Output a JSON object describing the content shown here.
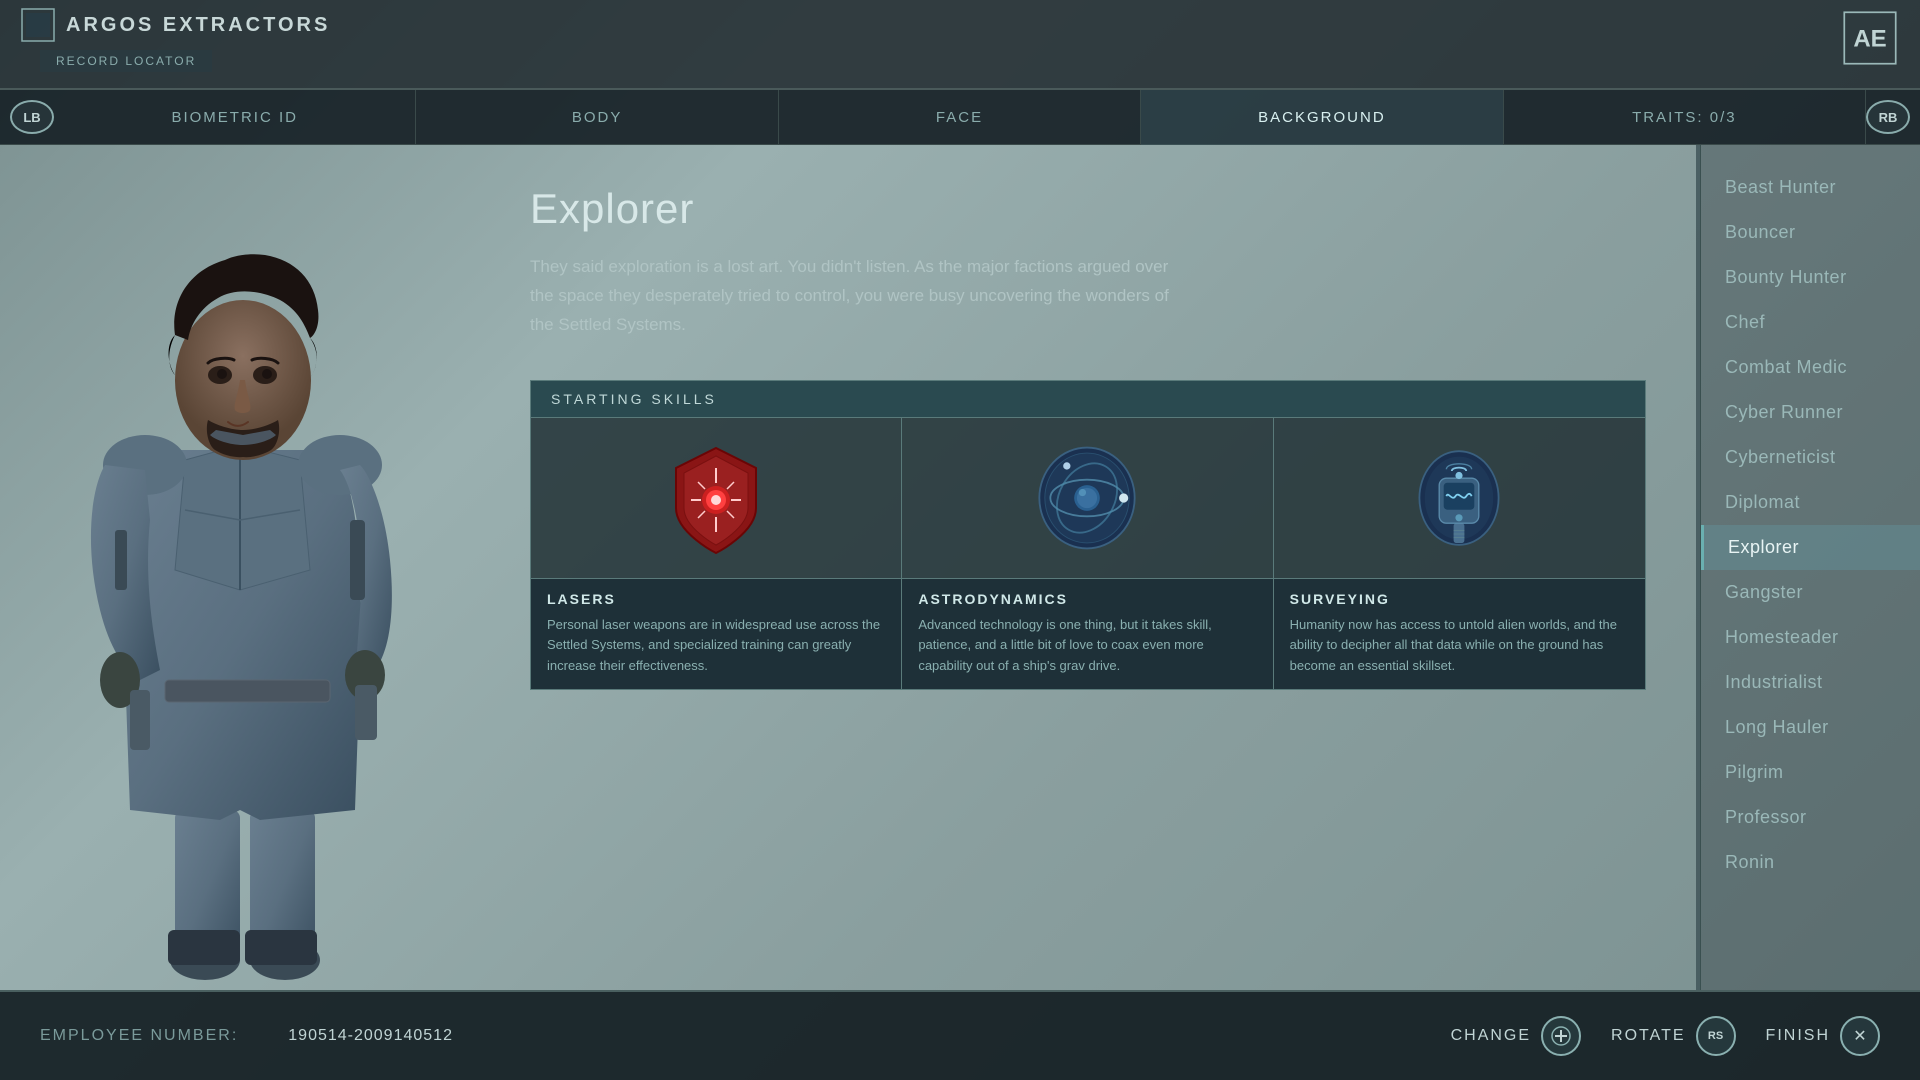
{
  "header": {
    "company": "ARGOS EXTRACTORS",
    "record_locator": "RECORD LOCATOR",
    "ae_logo": "AE"
  },
  "nav": {
    "left_btn": "LB",
    "right_btn": "RB",
    "tabs": [
      {
        "label": "BIOMETRIC ID",
        "id": "biometric"
      },
      {
        "label": "BODY",
        "id": "body"
      },
      {
        "label": "FACE",
        "id": "face"
      },
      {
        "label": "BACKGROUND",
        "id": "background",
        "active": true
      },
      {
        "label": "TRAITS: 0/3",
        "id": "traits"
      }
    ]
  },
  "background": {
    "title": "Explorer",
    "description": "They said exploration is a lost art. You didn't listen. As the major factions argued over the space they desperately tried to control, you were busy uncovering the wonders of the Settled Systems.",
    "skills_header": "STARTING SKILLS",
    "skills": [
      {
        "name": "LASERS",
        "description": "Personal laser weapons are in widespread use across the Settled Systems, and specialized training can greatly increase their effectiveness.",
        "icon_type": "laser"
      },
      {
        "name": "ASTRODYNAMICS",
        "description": "Advanced technology is one thing, but it takes skill, patience, and a little bit of love to coax even more capability out of a ship's grav drive.",
        "icon_type": "astro"
      },
      {
        "name": "SURVEYING",
        "description": "Humanity now has access to untold alien worlds, and the ability to decipher all that data while on the ground has become an essential skillset.",
        "icon_type": "survey"
      }
    ]
  },
  "bg_list": {
    "items": [
      {
        "label": "Beast Hunter",
        "id": "beast-hunter",
        "active": false
      },
      {
        "label": "Bouncer",
        "id": "bouncer",
        "active": false
      },
      {
        "label": "Bounty Hunter",
        "id": "bounty-hunter",
        "active": false
      },
      {
        "label": "Chef",
        "id": "chef",
        "active": false
      },
      {
        "label": "Combat Medic",
        "id": "combat-medic",
        "active": false
      },
      {
        "label": "Cyber Runner",
        "id": "cyber-runner",
        "active": false
      },
      {
        "label": "Cyberneticist",
        "id": "cyberneticist",
        "active": false
      },
      {
        "label": "Diplomat",
        "id": "diplomat",
        "active": false
      },
      {
        "label": "Explorer",
        "id": "explorer",
        "active": true
      },
      {
        "label": "Gangster",
        "id": "gangster",
        "active": false
      },
      {
        "label": "Homesteader",
        "id": "homesteader",
        "active": false
      },
      {
        "label": "Industrialist",
        "id": "industrialist",
        "active": false
      },
      {
        "label": "Long Hauler",
        "id": "long-hauler",
        "active": false
      },
      {
        "label": "Pilgrim",
        "id": "pilgrim",
        "active": false
      },
      {
        "label": "Professor",
        "id": "professor",
        "active": false
      },
      {
        "label": "Ronin",
        "id": "ronin",
        "active": false
      }
    ]
  },
  "bottom": {
    "employee_label": "EMPLOYEE NUMBER:",
    "employee_number": "190514-2009140512",
    "actions": [
      {
        "label": "CHANGE",
        "icon": "✛",
        "id": "change"
      },
      {
        "label": "ROTATE",
        "icon": "RS",
        "id": "rotate"
      },
      {
        "label": "FINISH",
        "icon": "✕",
        "id": "finish"
      }
    ]
  }
}
